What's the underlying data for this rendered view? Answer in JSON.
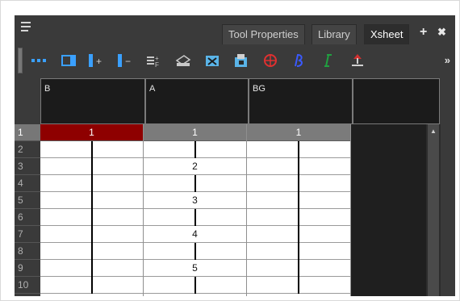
{
  "tabs": [
    {
      "label": "Tool Properties",
      "active": false
    },
    {
      "label": "Library",
      "active": false
    },
    {
      "label": "Xsheet",
      "active": true
    }
  ],
  "panel_controls": {
    "add": "+",
    "close": "✖"
  },
  "toolbar": {
    "buttons": [
      {
        "icon": "show-thumbnails-icon",
        "color": "#3aa0ff"
      },
      {
        "icon": "toggle-column-panel-icon",
        "color": "#3aa0ff"
      },
      {
        "icon": "add-column-icon",
        "color": "#3aa0ff"
      },
      {
        "icon": "remove-column-icon",
        "color": "#3aa0ff"
      },
      {
        "icon": "add-frames-icon",
        "color": "#c8c8c8"
      },
      {
        "icon": "print-xsheet-icon",
        "color": "#c8c8c8"
      },
      {
        "icon": "toggle-thumbnails-icon",
        "color": "#5ab4e8"
      },
      {
        "icon": "import-images-icon",
        "color": "#5ab4e8"
      },
      {
        "icon": "onion-skin-icon",
        "color": "#e03030"
      },
      {
        "icon": "bezier-drawing-icon",
        "color": "#3a5aff"
      },
      {
        "icon": "line-drawing-icon",
        "color": "#20a040"
      },
      {
        "icon": "extend-exposure-icon",
        "color": "#d0d0d0"
      }
    ],
    "more": "»"
  },
  "columns": [
    {
      "name": "B",
      "selected": true,
      "cells": [
        "1",
        "",
        "",
        "",
        "",
        "",
        "",
        "",
        "",
        ""
      ]
    },
    {
      "name": "A",
      "selected": false,
      "cells": [
        "1",
        "",
        "2",
        "",
        "3",
        "",
        "4",
        "",
        "5",
        ""
      ]
    },
    {
      "name": "BG",
      "selected": false,
      "cells": [
        "1",
        "",
        "",
        "",
        "",
        "",
        "",
        "",
        "",
        ""
      ]
    }
  ],
  "row_numbers": [
    "1",
    "2",
    "3",
    "4",
    "5",
    "6",
    "7",
    "8",
    "9",
    "10"
  ]
}
